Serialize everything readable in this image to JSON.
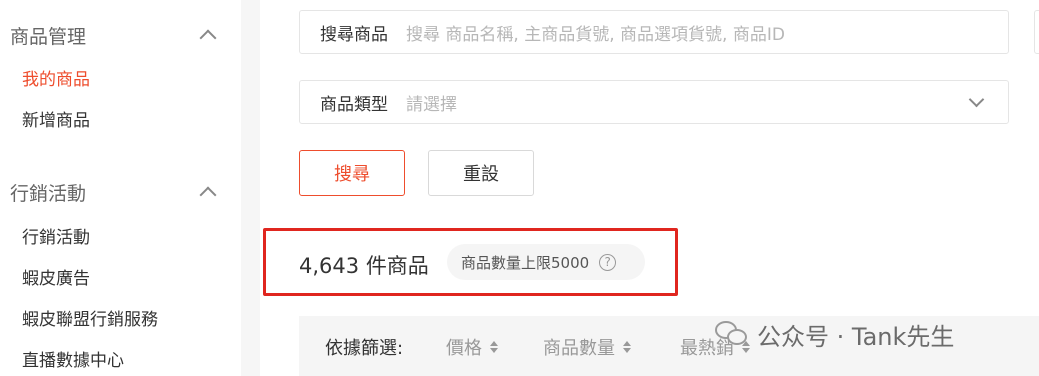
{
  "sidebar": {
    "sections": [
      {
        "title": "商品管理",
        "items": [
          "我的商品",
          "新增商品"
        ]
      },
      {
        "title": "行銷活動",
        "items": [
          "行銷活動",
          "蝦皮廣告",
          "蝦皮聯盟行銷服務",
          "直播數據中心"
        ]
      }
    ],
    "active_item": "我的商品"
  },
  "search": {
    "label": "搜尋商品",
    "placeholder": "搜尋 商品名稱, 主商品貨號, 商品選項貨號, 商品ID"
  },
  "category": {
    "label": "商品類型",
    "placeholder": "請選擇"
  },
  "buttons": {
    "search": "搜尋",
    "reset": "重設"
  },
  "summary": {
    "count": "4,643",
    "count_suffix": "件商品",
    "limit_text": "商品數量上限5000"
  },
  "filter": {
    "label": "依據篩選:",
    "options": [
      "價格",
      "商品數量",
      "最熱銷"
    ]
  },
  "watermark": {
    "text": "公众号 · Tank先生"
  },
  "colors": {
    "accent": "#ee4d2d",
    "highlight": "#e0261f"
  }
}
